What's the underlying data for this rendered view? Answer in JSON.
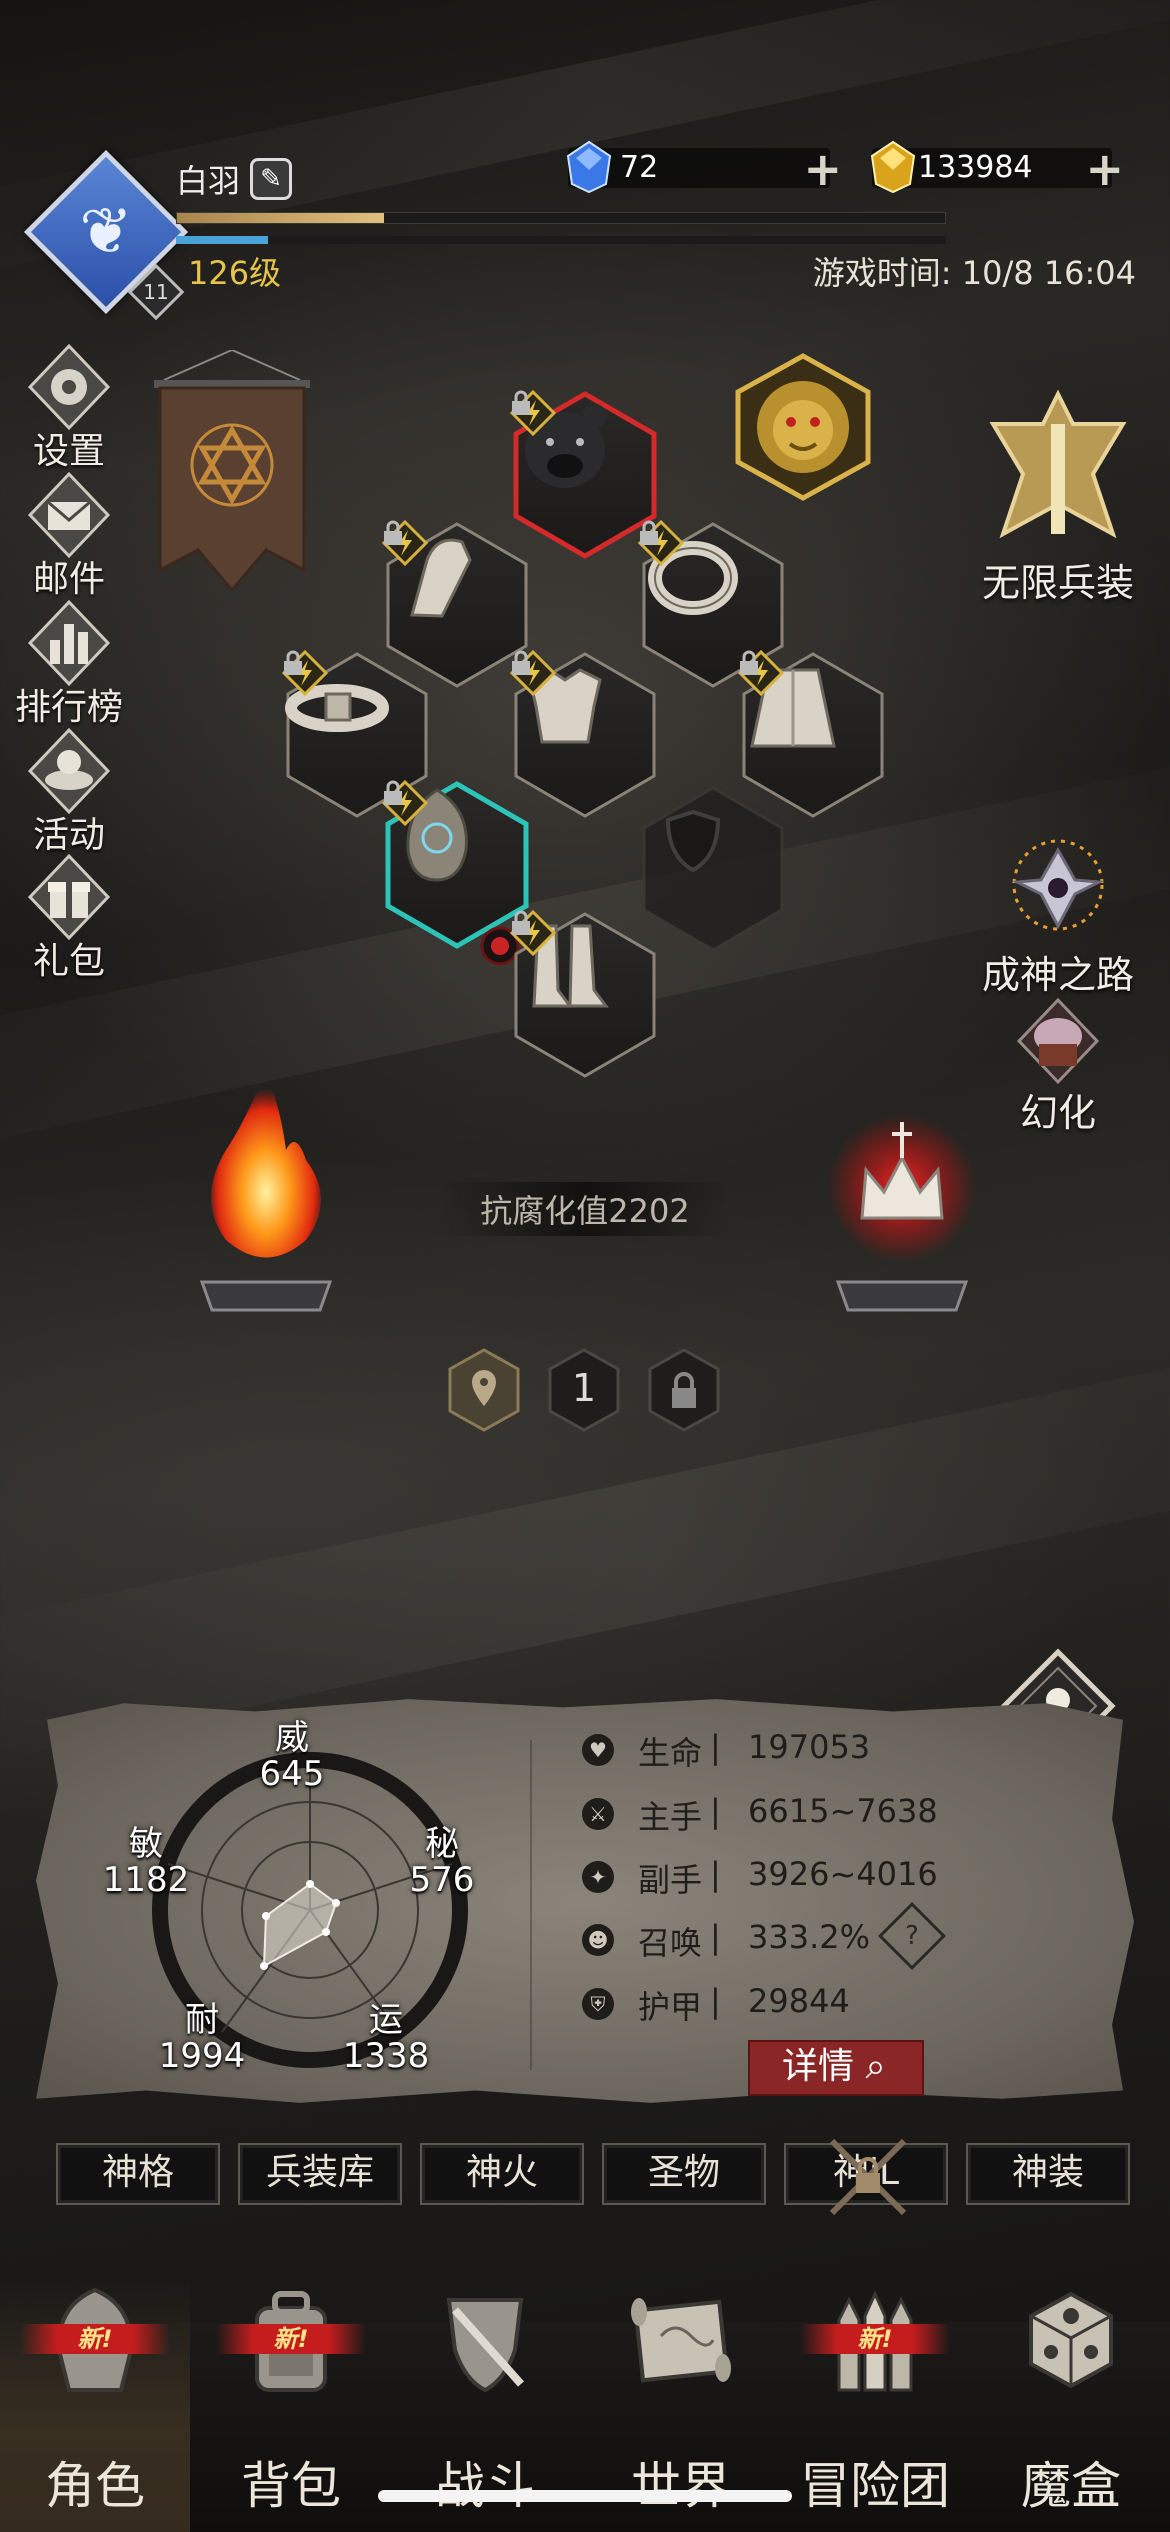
{
  "player": {
    "name": "白羽",
    "level_badge": "11",
    "level_text": "126级",
    "exp_fraction": 0.27,
    "sub_bar_fraction": 0.12
  },
  "currency": {
    "gems": "72",
    "gold": "133984"
  },
  "game_time": "游戏时间: 10/8 16:04",
  "left_menu": [
    {
      "label": "设置",
      "icon": "gear-icon"
    },
    {
      "label": "邮件",
      "icon": "mail-icon"
    },
    {
      "label": "排行榜",
      "icon": "ranking-icon"
    },
    {
      "label": "活动",
      "icon": "activity-icon"
    },
    {
      "label": "礼包",
      "icon": "gift-icon"
    }
  ],
  "right_features": [
    {
      "label": "无限兵装",
      "icon": "infinite-weapon-icon"
    },
    {
      "label": "成神之路",
      "icon": "godhood-path-icon"
    },
    {
      "label": "幻化",
      "icon": "transmog-icon"
    }
  ],
  "corrosion": "抗腐化值2202",
  "loadout_slots": [
    "location-icon",
    "1",
    "lock-icon"
  ],
  "stats": {
    "attributes": {
      "wei_label": "威",
      "wei": "645",
      "mi_label": "秘",
      "mi": "576",
      "yun_label": "运",
      "yun": "1338",
      "nai_label": "耐",
      "nai": "1994",
      "min_label": "敏",
      "min": "1182"
    },
    "rows": [
      {
        "label": "生命",
        "value": "197053",
        "icon": "heart-icon"
      },
      {
        "label": "主手",
        "value": "6615~7638",
        "icon": "sword-icon"
      },
      {
        "label": "副手",
        "value": "3926~4016",
        "icon": "offhand-icon"
      },
      {
        "label": "召唤",
        "value": "333.2%",
        "icon": "summon-icon"
      },
      {
        "label": "护甲",
        "value": "29844",
        "icon": "armor-icon"
      }
    ],
    "separator": "|",
    "help": "?",
    "detail_button": "详情"
  },
  "tabs": [
    "神格",
    "兵装库",
    "神火",
    "圣物",
    "神iL",
    "神装"
  ],
  "nav": [
    {
      "label": "角色",
      "icon": "helmet-icon",
      "new": "新!"
    },
    {
      "label": "背包",
      "icon": "backpack-icon",
      "new": "新!"
    },
    {
      "label": "战斗",
      "icon": "battle-icon",
      "new": ""
    },
    {
      "label": "世界",
      "icon": "world-map-icon",
      "new": ""
    },
    {
      "label": "冒险团",
      "icon": "adventure-team-icon",
      "new": "新!"
    },
    {
      "label": "魔盒",
      "icon": "magic-box-icon",
      "new": ""
    }
  ],
  "colors": {
    "level": "#e7c44a",
    "exp": "#e0c07e",
    "detail_button": "#8b2626",
    "avatar": "#3f6bc4",
    "new_tag": "#c51d1d"
  }
}
